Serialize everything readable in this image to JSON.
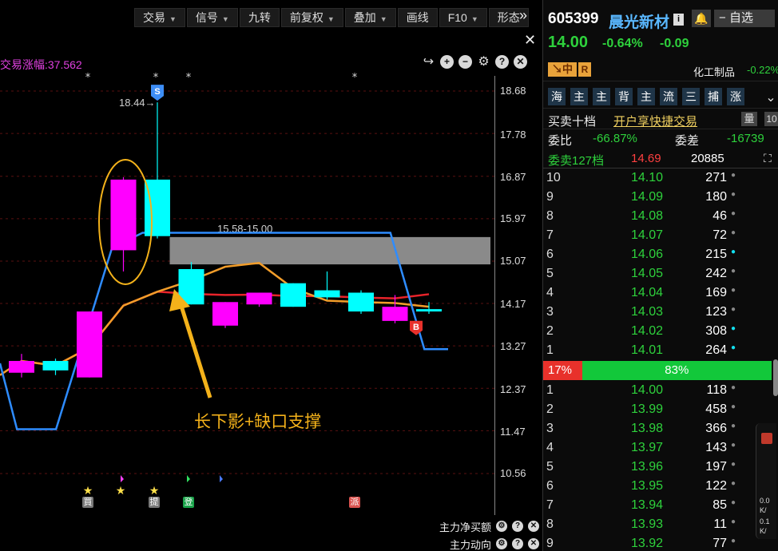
{
  "toolbar": {
    "items": [
      {
        "label": "交易",
        "dropdown": true
      },
      {
        "label": "信号",
        "dropdown": true
      },
      {
        "label": "九转",
        "dropdown": false
      },
      {
        "label": "前复权",
        "dropdown": true
      },
      {
        "label": "叠加",
        "dropdown": true
      },
      {
        "label": "画线",
        "dropdown": false
      },
      {
        "label": "F10",
        "dropdown": true
      },
      {
        "label": "形态",
        "dropdown": false
      }
    ]
  },
  "chart": {
    "indicator_label": "交易涨幅:37.562",
    "price_axis": [
      "18.68",
      "17.78",
      "16.87",
      "15.97",
      "15.07",
      "14.17",
      "13.27",
      "12.37",
      "11.47",
      "10.56"
    ],
    "high_annotation": "18.44",
    "gap_annotation": "15.58-15.00",
    "annotation_text": "长下影+缺口支撑",
    "sell_marker": "S",
    "buy_marker": "B",
    "signal_badges": [
      {
        "label": "買",
        "color": "#777777"
      },
      {
        "label": "提",
        "color": "#777777"
      },
      {
        "label": "登",
        "color": "#1aa34a"
      },
      {
        "label": "派",
        "color": "#d9534f"
      }
    ],
    "sub_indicators": [
      "主力净买额",
      "主力动向"
    ],
    "colors": {
      "up_candle": "#ff00ff",
      "down_candle": "#00ffff",
      "gap_zone": "#8a8a8a",
      "blue_line": "#2e8cff",
      "orange_ma": "#f29d2a",
      "red_ma": "#e8232a",
      "annotation": "#f4b21a"
    }
  },
  "chart_data": {
    "type": "candlestick",
    "candles": [
      {
        "open": 12.7,
        "close": 12.95,
        "high": 13.1,
        "low": 12.6
      },
      {
        "open": 12.95,
        "close": 12.75,
        "high": 13.0,
        "low": 12.65
      },
      {
        "open": 12.6,
        "close": 14.0,
        "high": 14.0,
        "low": 12.6
      },
      {
        "open": 15.3,
        "close": 16.8,
        "high": 16.85,
        "low": 14.85
      },
      {
        "open": 16.8,
        "close": 15.6,
        "high": 18.44,
        "low": 15.55
      },
      {
        "open": 14.9,
        "close": 14.15,
        "high": 15.05,
        "low": 14.15
      },
      {
        "open": 13.7,
        "close": 14.2,
        "high": 14.2,
        "low": 13.65
      },
      {
        "open": 14.15,
        "close": 14.4,
        "high": 14.4,
        "low": 14.1
      },
      {
        "open": 14.6,
        "close": 14.1,
        "high": 14.6,
        "low": 14.1
      },
      {
        "open": 14.45,
        "close": 14.3,
        "high": 14.85,
        "low": 14.25
      },
      {
        "open": 14.4,
        "close": 14.0,
        "high": 14.45,
        "low": 13.95
      },
      {
        "open": 13.8,
        "close": 14.1,
        "high": 14.35,
        "low": 13.75
      },
      {
        "open": 14.05,
        "close": 14.0,
        "high": 14.2,
        "low": 13.95
      }
    ],
    "ylim": [
      10.56,
      18.68
    ]
  },
  "stock": {
    "code": "605399",
    "name": "晨光新材",
    "price": "14.00",
    "change_pct": "-0.64%",
    "change_amt": "-0.09",
    "tag_main": "中",
    "tag_r": "R",
    "industry": "化工制品",
    "industry_change": "-0.22%",
    "watch_label": "自选"
  },
  "nav": [
    "海",
    "主",
    "主",
    "背",
    "主",
    "流",
    "三",
    "捕",
    "涨"
  ],
  "orderbook": {
    "title": "买卖十档",
    "quick_trade": "开户享快捷交易",
    "ratio_label": "委比",
    "ratio_value": "-66.87%",
    "diff_label": "委差",
    "diff_value": "-16739",
    "sell_summary_label": "委卖127档",
    "sell_summary_price": "14.69",
    "sell_summary_volume": "20885",
    "asks": [
      {
        "level": "10",
        "price": "14.10",
        "volume": "271",
        "dot": "grey"
      },
      {
        "level": "9",
        "price": "14.09",
        "volume": "180",
        "dot": "grey"
      },
      {
        "level": "8",
        "price": "14.08",
        "volume": "46",
        "dot": "grey"
      },
      {
        "level": "7",
        "price": "14.07",
        "volume": "72",
        "dot": "grey"
      },
      {
        "level": "6",
        "price": "14.06",
        "volume": "215",
        "dot": "cyan"
      },
      {
        "level": "5",
        "price": "14.05",
        "volume": "242",
        "dot": "grey"
      },
      {
        "level": "4",
        "price": "14.04",
        "volume": "169",
        "dot": "grey"
      },
      {
        "level": "3",
        "price": "14.03",
        "volume": "123",
        "dot": "grey"
      },
      {
        "level": "2",
        "price": "14.02",
        "volume": "308",
        "dot": "cyan"
      },
      {
        "level": "1",
        "price": "14.01",
        "volume": "264",
        "dot": "cyan"
      }
    ],
    "sell_pct": "17%",
    "buy_pct": "83%",
    "sell_fraction": 0.17,
    "bids": [
      {
        "level": "1",
        "price": "14.00",
        "volume": "118",
        "dot": "grey"
      },
      {
        "level": "2",
        "price": "13.99",
        "volume": "458",
        "dot": "grey"
      },
      {
        "level": "3",
        "price": "13.98",
        "volume": "366",
        "dot": "grey"
      },
      {
        "level": "4",
        "price": "13.97",
        "volume": "143",
        "dot": "grey"
      },
      {
        "level": "5",
        "price": "13.96",
        "volume": "197",
        "dot": "grey"
      },
      {
        "level": "6",
        "price": "13.95",
        "volume": "122",
        "dot": "grey"
      },
      {
        "level": "7",
        "price": "13.94",
        "volume": "85",
        "dot": "grey"
      },
      {
        "level": "8",
        "price": "13.93",
        "volume": "11",
        "dot": "grey"
      },
      {
        "level": "9",
        "price": "13.92",
        "volume": "77",
        "dot": "grey"
      }
    ]
  },
  "side_widget": {
    "values": [
      "0.0",
      "0.1"
    ],
    "labels": [
      "K/",
      "K/"
    ]
  }
}
